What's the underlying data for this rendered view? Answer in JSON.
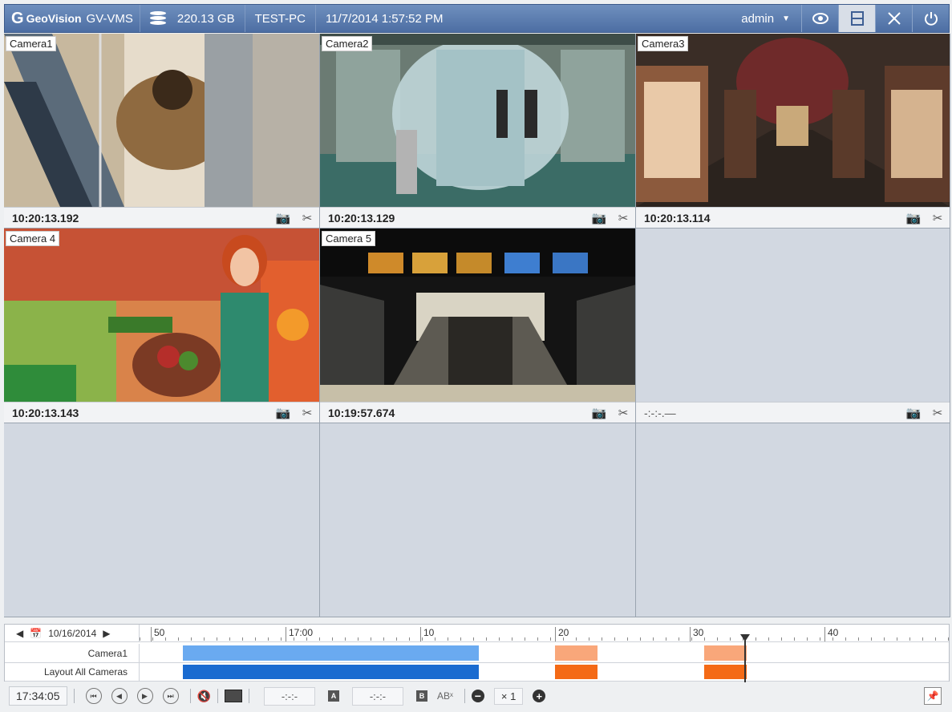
{
  "header": {
    "logo_glyph": "G",
    "brand": "GeoVision",
    "product": "GV-VMS",
    "storage": "220.13 GB",
    "pc": "TEST-PC",
    "datetime": "11/7/2014 1:57:52 PM",
    "user": "admin"
  },
  "cameras": [
    {
      "label": "Camera1",
      "time": "10:20:13.192"
    },
    {
      "label": "Camera2",
      "time": "10:20:13.129"
    },
    {
      "label": "Camera3",
      "time": "10:20:13.114"
    },
    {
      "label": "Camera 4",
      "time": "10:20:13.143"
    },
    {
      "label": "Camera 5",
      "time": "10:19:57.674"
    },
    {
      "label": "",
      "time": "-:-:-.—"
    }
  ],
  "timeline": {
    "date": "10/16/2014",
    "ticks": [
      "50",
      "17:00",
      "10",
      "20",
      "30",
      "40"
    ],
    "rows": [
      "Camera1",
      "Layout All Cameras"
    ]
  },
  "toolbar": {
    "time": "17:34:05",
    "a_field": "-:-:-",
    "a_label": "A",
    "b_field": "-:-:-",
    "b_label": "B",
    "ab_label": "ABˣ",
    "speed": "× 1"
  },
  "colors": {
    "header": "#5677ab",
    "seg_light_blue": "#6aaaf0",
    "seg_dark_blue": "#1a6bd0",
    "seg_light_orange": "#f9a77a",
    "seg_orange": "#f46a16"
  }
}
